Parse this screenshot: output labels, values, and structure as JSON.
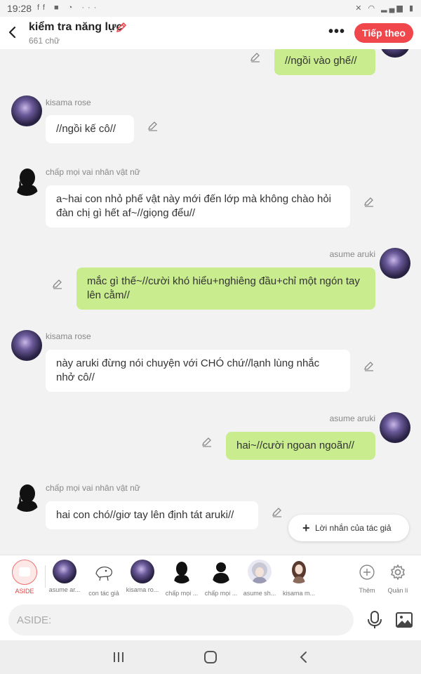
{
  "status_bar": {
    "time": "19:28"
  },
  "header": {
    "title": "kiểm tra năng lực",
    "word_count": "661 chữ",
    "next_label": "Tiếp theo"
  },
  "messages": [
    {
      "side": "right",
      "name": "",
      "text": "//ngồi vào ghế//"
    },
    {
      "side": "left",
      "name": "kisama rose",
      "text": "//ngồi kế cô//"
    },
    {
      "side": "left",
      "name": "chấp mọi vai nhân vật nữ",
      "text": "a~hai con nhỏ phế vật này mới đến lớp mà không chào hỏi đàn chị gì hết af~//giọng đểu//"
    },
    {
      "side": "right",
      "name": "asume aruki",
      "text": "mắc gì thế~//cười khó hiểu+nghiêng đầu+chỉ một ngón tay lên cằm//"
    },
    {
      "side": "left",
      "name": "kisama rose",
      "text": "này aruki đừng nói chuyện với CHÓ chứ//lạnh lùng nhắc nhở cô//"
    },
    {
      "side": "right",
      "name": "asume aruki",
      "text": "hai~//cười ngoan ngoãn//"
    },
    {
      "side": "left",
      "name": "chấp mọi vai nhân vật nữ",
      "text": "hai con chó//giơ tay lên định tát aruki//"
    }
  ],
  "author_note_button": "Lời nhắn của tác giả",
  "character_bar": {
    "aside_label": "ASIDE",
    "characters": [
      {
        "label": "asume ar...",
        "icon": "avatar-purple"
      },
      {
        "label": "con tác giả",
        "icon": "avatar-sketch"
      },
      {
        "label": "kisama ro...",
        "icon": "avatar-purple"
      },
      {
        "label": "chấp mọi ...",
        "icon": "avatar-silhouette-female"
      },
      {
        "label": "chấp mọi ...",
        "icon": "avatar-silhouette-male"
      },
      {
        "label": "asume sh...",
        "icon": "avatar-silver-hair"
      },
      {
        "label": "kisama m...",
        "icon": "avatar-brown-hair"
      }
    ],
    "add_label": "Thêm",
    "manage_label": "Quản lí"
  },
  "input": {
    "placeholder": "ASIDE:"
  },
  "colors": {
    "accent": "#f0474d",
    "right_bubble": "#c8ec8e",
    "left_bubble": "#ffffff",
    "background": "#f2f2f2"
  }
}
